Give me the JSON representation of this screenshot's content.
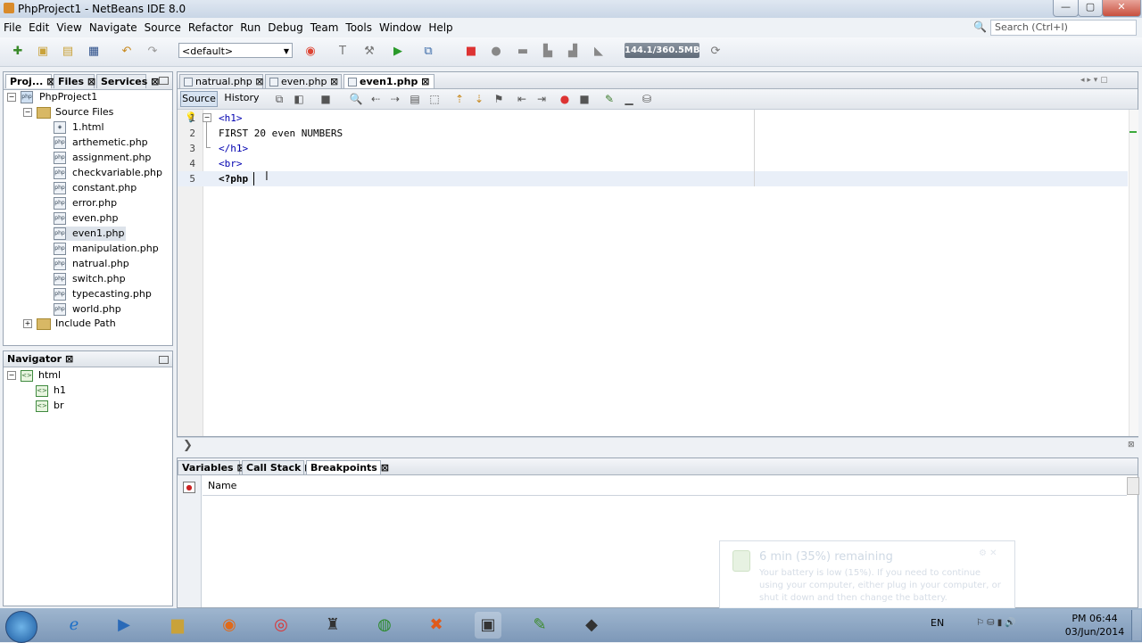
{
  "window": {
    "title": "PhpProject1 - NetBeans IDE 8.0",
    "controls": [
      "—",
      "▢",
      "✕"
    ]
  },
  "menu": [
    "File",
    "Edit",
    "View",
    "Navigate",
    "Source",
    "Refactor",
    "Run",
    "Debug",
    "Team",
    "Tools",
    "Window",
    "Help"
  ],
  "search": {
    "placeholder": "Search (Ctrl+I)"
  },
  "toolbar": {
    "config": "<default>",
    "memory": "144.1/360.5MB"
  },
  "projects_panel": {
    "tabs": [
      "Proj...",
      "Files",
      "Services"
    ],
    "root": "PhpProject1",
    "source_files": "Source Files",
    "files": [
      "1.html",
      "arthemetic.php",
      "assignment.php",
      "checkvariable.php",
      "constant.php",
      "error.php",
      "even.php",
      "even1.php",
      "manipulation.php",
      "natrual.php",
      "switch.php",
      "typecasting.php",
      "world.php"
    ],
    "selected": "even1.php",
    "include_path": "Include Path"
  },
  "navigator": {
    "title": "Navigator",
    "root": "html",
    "children": [
      "h1",
      "br"
    ]
  },
  "editor": {
    "tabs": [
      "natrual.php",
      "even.php",
      "even1.php"
    ],
    "active_tab": "even1.php",
    "modes": [
      "Source",
      "History"
    ],
    "lines": [
      {
        "no": "1",
        "text": "<h1>"
      },
      {
        "no": "2",
        "text": "FIRST 20 even NUMBERS"
      },
      {
        "no": "3",
        "text": "</h1>"
      },
      {
        "no": "4",
        "text": "<br>"
      },
      {
        "no": "5",
        "text": "<?php"
      }
    ]
  },
  "debug_panel": {
    "tabs": [
      "Variables",
      "Call Stack",
      "Breakpoints"
    ],
    "active_tab": "Breakpoints",
    "column_header": "Name"
  },
  "notification": {
    "title": "6 min (35%) remaining",
    "body": "Your battery is low (15%). If you need to continue using your computer, either plug in your computer, or shut it down and then change the battery."
  },
  "tray": {
    "language": "EN",
    "time": "PM 06:44",
    "date": "03/Jun/2014"
  }
}
